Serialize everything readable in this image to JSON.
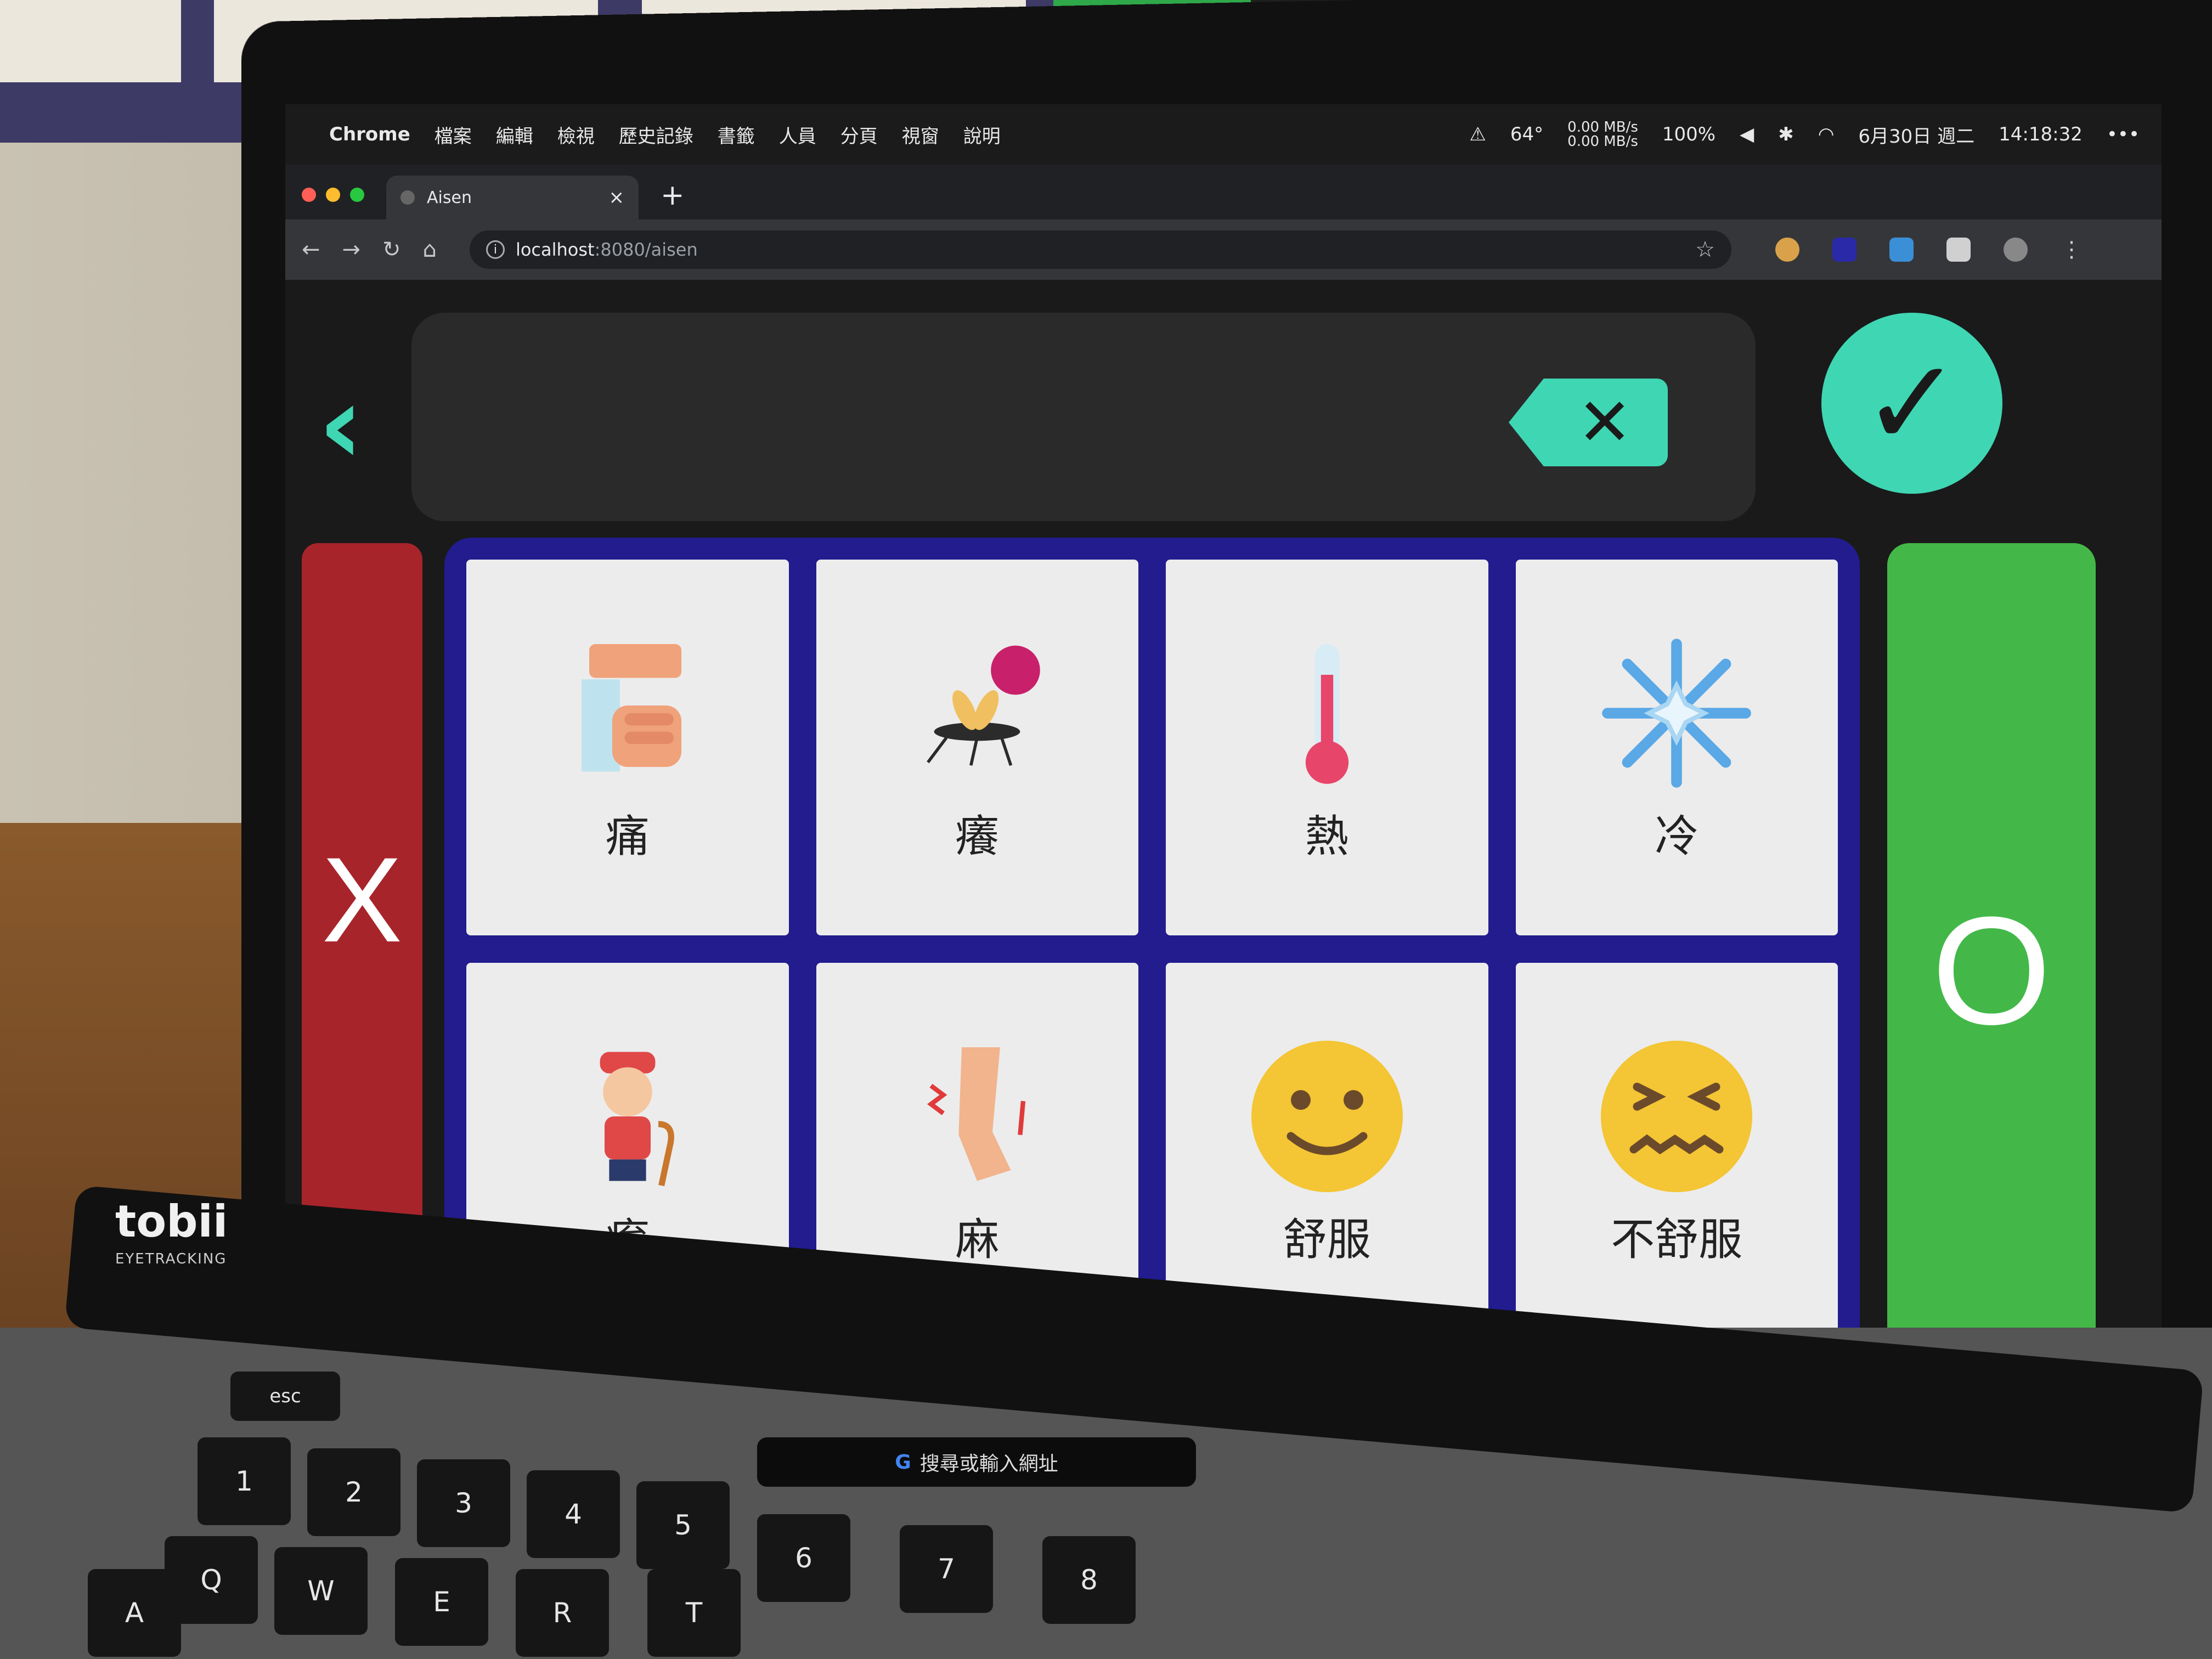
{
  "background": {
    "cards": [
      "舒服",
      "不舒服"
    ]
  },
  "menubar": {
    "app": "Chrome",
    "items": [
      "檔案",
      "編輯",
      "檢視",
      "歷史記錄",
      "書籤",
      "人員",
      "分頁",
      "視窗",
      "說明"
    ],
    "temp": "64°",
    "net_up": "0.00 MB/s",
    "net_down": "0.00 MB/s",
    "battery": "100%",
    "date": "6月30日 週二",
    "time": "14:18:32"
  },
  "browser": {
    "tab_title": "Aisen",
    "url_host": "localhost",
    "url_path": ":8080/aisen"
  },
  "app": {
    "no_label": "X",
    "yes_label": "O",
    "cards": [
      {
        "label": "痛",
        "icon": "hand-pain-icon"
      },
      {
        "label": "癢",
        "icon": "mosquito-icon"
      },
      {
        "label": "熱",
        "icon": "thermometer-icon"
      },
      {
        "label": "冷",
        "icon": "snowflake-icon"
      },
      {
        "label": "痠",
        "icon": "old-man-icon"
      },
      {
        "label": "麻",
        "icon": "leg-numb-icon"
      },
      {
        "label": "舒服",
        "icon": "smile-face-icon"
      },
      {
        "label": "不舒服",
        "icon": "uncomfortable-face-icon"
      }
    ]
  },
  "hardware": {
    "brand": "tobii",
    "brand_sub": "EYETRACKING",
    "touchbar_search": "搜尋或輸入網址",
    "keys": [
      "esc",
      "1",
      "2",
      "3",
      "4",
      "5",
      "6",
      "7",
      "8",
      "Q",
      "W",
      "E",
      "R",
      "T",
      "A"
    ]
  }
}
